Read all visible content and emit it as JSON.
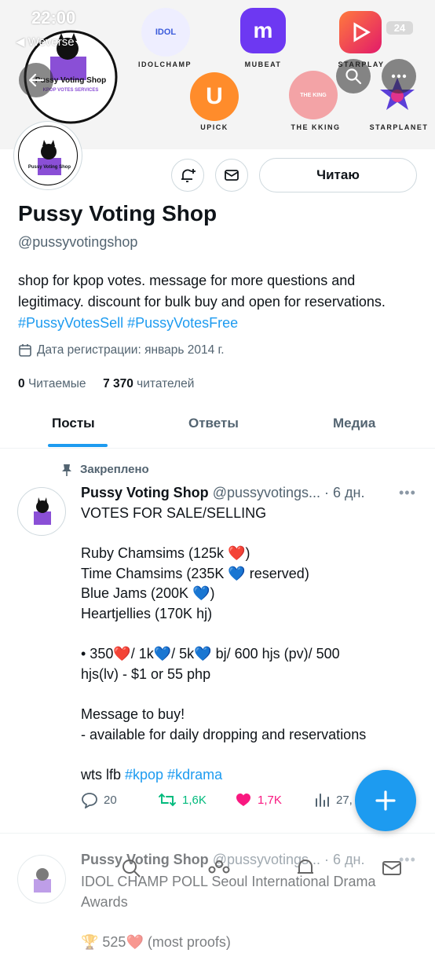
{
  "status": {
    "time": "22:00",
    "back_app": "◀ Weverse",
    "battery": "24"
  },
  "banner": {
    "apps": [
      {
        "label": "IDOLCHAMP",
        "icon": "idolchamp-icon",
        "text": "IDOL"
      },
      {
        "label": "MUBEAT",
        "icon": "mubeat-icon",
        "text": "m"
      },
      {
        "label": "STARPLAY",
        "icon": "starplay-icon",
        "text": ""
      },
      {
        "label": "UPICK",
        "icon": "upick-icon",
        "text": ""
      },
      {
        "label": "THE KKING",
        "icon": "thekking-icon",
        "text": "THE KING"
      },
      {
        "label": "STARPLANET",
        "icon": "starplanet-icon",
        "text": ""
      }
    ],
    "logo_line1": "Pussy Voting Shop",
    "logo_line2": "KPOP VOTES SERVICES"
  },
  "profile": {
    "name": "Pussy Voting Shop",
    "handle": "@pussyvotingshop",
    "bio_text": "shop for kpop votes. message for more questions and legitimacy. discount for bulk buy and open for reservations.",
    "bio_tags": "#PussyVotesSell #PussyVotesFree",
    "joined": "Дата регистрации: январь 2014 г.",
    "following_count": "0",
    "following_label": "Читаемые",
    "followers_count": "7 370",
    "followers_label": "читателей",
    "follow_button": "Читаю"
  },
  "tabs": [
    "Посты",
    "Ответы",
    "Медиа"
  ],
  "pinned_label": "Закреплено",
  "post": {
    "name": "Pussy Voting Shop",
    "meta": "@pussyvotings... · 6 дн.",
    "more": "•••",
    "body_lines": [
      "VOTES FOR SALE/SELLING",
      "",
      "Ruby Chamsims (125k ❤️)",
      "Time Chamsims (235K 💙 reserved)",
      "Blue Jams (200K 💙)",
      "Heartjellies (170K hj)",
      "",
      "• 350❤️/ 1k💙/ 5k💙 bj/ 600 hjs (pv)/ 500",
      "hjs(lv) - $1 or 55 php",
      "",
      "Message to buy!",
      "- available for daily dropping and reservations",
      "",
      "wts lfb "
    ],
    "tags": "#kpop #kdrama",
    "replies": "20",
    "retweets": "1,6K",
    "likes": "1,7K",
    "views": "27,"
  },
  "post2": {
    "name": "Pussy Voting Shop",
    "meta": "@pussyvotings... · 6 дн.",
    "line1": "IDOL CHAMP POLL Seoul International Drama",
    "line2": "Awards",
    "line3": "🏆 525❤️ (most proofs)"
  },
  "colors": {
    "accent": "#1d9bf0",
    "retweet": "#00ba7c",
    "like": "#f91880",
    "text": "#0f1419",
    "muted": "#536471"
  }
}
